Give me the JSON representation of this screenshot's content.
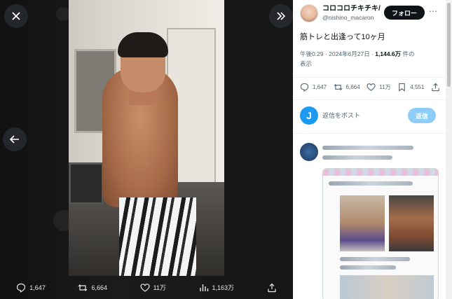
{
  "media_viewer": {
    "close_icon": "close-icon",
    "expand_icon": "expand-panel-icon",
    "prev_icon": "arrow-left-icon",
    "actions": [
      {
        "name": "reply",
        "icon": "reply-icon",
        "count": "1,647"
      },
      {
        "name": "repost",
        "icon": "repost-icon",
        "count": "6,664"
      },
      {
        "name": "like",
        "icon": "heart-icon",
        "count": "11万"
      },
      {
        "name": "views",
        "icon": "views-icon",
        "count": "1,163万"
      },
      {
        "name": "share",
        "icon": "share-icon",
        "count": ""
      }
    ]
  },
  "tweet": {
    "display_name": "コロコロチキチキ/",
    "handle": "@nishino_macaron",
    "follow_label": "フォロー",
    "text": "筋トレと出逢って10ヶ月",
    "time": "午後0:29",
    "date": "2024年6月27日",
    "views": "1,144.6万",
    "views_suffix": "件の",
    "views_label": "表示",
    "actions": [
      {
        "name": "reply",
        "icon": "reply-icon",
        "count": "1,647"
      },
      {
        "name": "repost",
        "icon": "repost-icon",
        "count": "6,664"
      },
      {
        "name": "like",
        "icon": "heart-icon",
        "count": "11万"
      },
      {
        "name": "bookmark",
        "icon": "bookmark-icon",
        "count": "4,551"
      },
      {
        "name": "share",
        "icon": "share-icon",
        "count": ""
      }
    ]
  },
  "reply_box": {
    "avatar_letter": "J",
    "placeholder": "返信をポスト",
    "button_label": "返信"
  },
  "colors": {
    "accent": "#1d9bf0",
    "follow_bg": "#0f1419",
    "viewer_bg": "#0b0b0b"
  }
}
